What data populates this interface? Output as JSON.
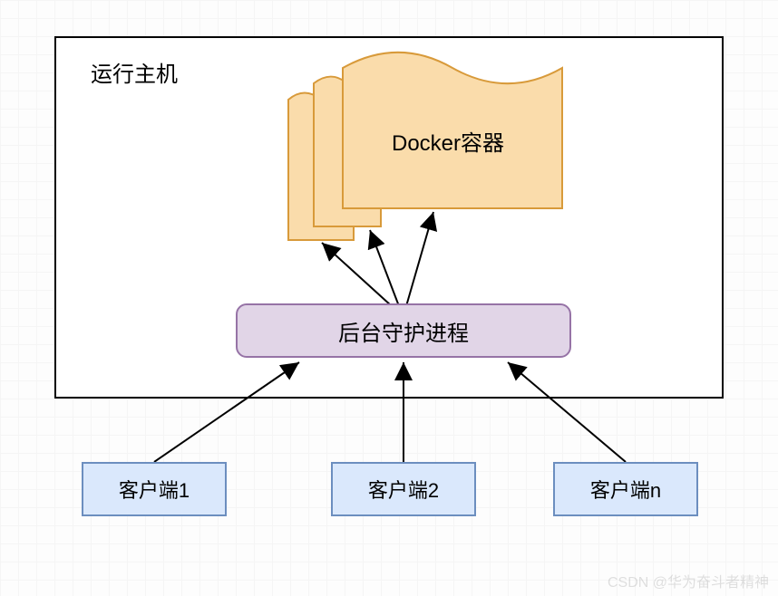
{
  "host": {
    "label": "运行主机"
  },
  "containers": {
    "label": "Docker容器"
  },
  "daemon": {
    "label": "后台守护进程"
  },
  "clients": {
    "c1": "客户端1",
    "c2": "客户端2",
    "cn": "客户端n"
  },
  "watermark": "CSDN @华为奋斗者精神",
  "colors": {
    "containerFill": "#fadcab",
    "containerStroke": "#d89a3a",
    "daemonFill": "#e1d5e7",
    "daemonStroke": "#9673a6",
    "clientFill": "#dae8fc",
    "clientStroke": "#6c8ebf"
  }
}
